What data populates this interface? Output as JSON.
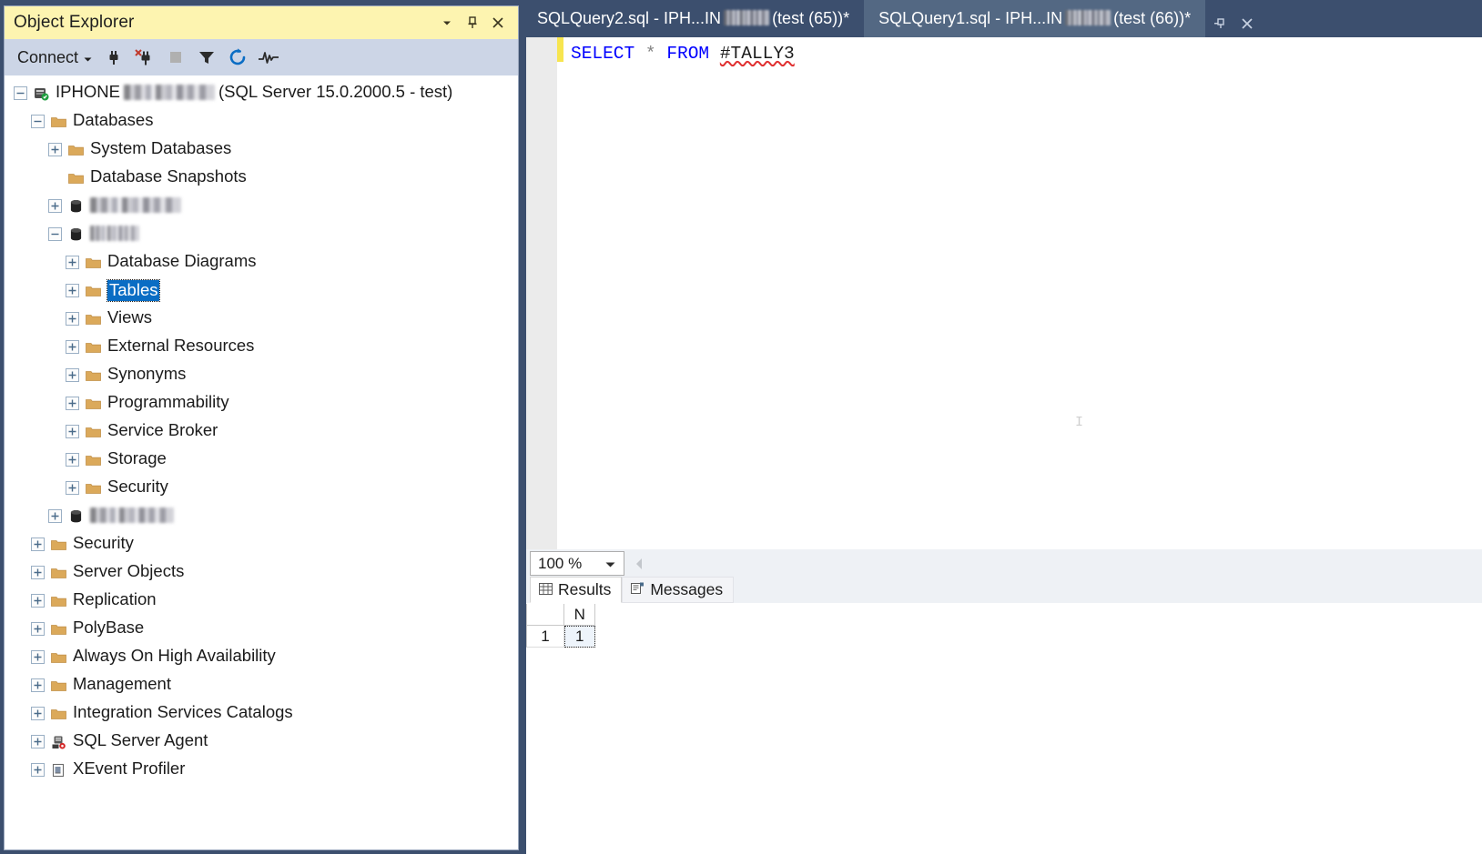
{
  "object_explorer": {
    "title": "Object Explorer",
    "titlebar_buttons": [
      {
        "name": "window-dropdown-icon",
        "glyph": "▼"
      },
      {
        "name": "pin-icon",
        "glyph": "pin"
      },
      {
        "name": "close-icon",
        "glyph": "✕"
      }
    ],
    "toolbar": {
      "connect_label": "Connect",
      "connect_dropdown_glyph": "▾",
      "icons": [
        {
          "name": "connect-icon",
          "title": "Connect"
        },
        {
          "name": "disconnect-icon",
          "title": "Disconnect"
        },
        {
          "name": "stop-icon",
          "title": "Stop"
        },
        {
          "name": "filter-icon",
          "title": "Filter"
        },
        {
          "name": "refresh-icon",
          "title": "Refresh"
        },
        {
          "name": "activity-monitor-icon",
          "title": "Activity Monitor"
        }
      ]
    },
    "tree": [
      {
        "label": "IPHONE",
        "blurred_suffix": true,
        "suffix": " (SQL Server 15.0.2000.5 - test)",
        "indent": 0,
        "expander": "minus",
        "icon": "server-icon"
      },
      {
        "label": "Databases",
        "indent": 1,
        "expander": "minus",
        "icon": "folder-icon"
      },
      {
        "label": "System Databases",
        "indent": 2,
        "expander": "plus",
        "icon": "folder-icon"
      },
      {
        "label": "Database Snapshots",
        "indent": 2,
        "expander": "none",
        "icon": "folder-icon"
      },
      {
        "label": "",
        "blurred_only": true,
        "blur_width": 100,
        "indent": 2,
        "expander": "plus",
        "icon": "database-icon"
      },
      {
        "label": "",
        "blurred_only": true,
        "blur_width": 54,
        "indent": 2,
        "expander": "minus",
        "icon": "database-icon"
      },
      {
        "label": "Database Diagrams",
        "indent": 3,
        "expander": "plus",
        "icon": "folder-icon"
      },
      {
        "label": "Tables",
        "indent": 3,
        "expander": "plus",
        "icon": "folder-icon",
        "selected": true
      },
      {
        "label": "Views",
        "indent": 3,
        "expander": "plus",
        "icon": "folder-icon"
      },
      {
        "label": "External Resources",
        "indent": 3,
        "expander": "plus",
        "icon": "folder-icon"
      },
      {
        "label": "Synonyms",
        "indent": 3,
        "expander": "plus",
        "icon": "folder-icon"
      },
      {
        "label": "Programmability",
        "indent": 3,
        "expander": "plus",
        "icon": "folder-icon"
      },
      {
        "label": "Service Broker",
        "indent": 3,
        "expander": "plus",
        "icon": "folder-icon"
      },
      {
        "label": "Storage",
        "indent": 3,
        "expander": "plus",
        "icon": "folder-icon"
      },
      {
        "label": "Security",
        "indent": 3,
        "expander": "plus",
        "icon": "folder-icon"
      },
      {
        "label": "",
        "blurred_only": true,
        "blur_width": 92,
        "indent": 2,
        "expander": "plus",
        "icon": "database-icon"
      },
      {
        "label": "Security",
        "indent": 1,
        "expander": "plus",
        "icon": "folder-icon"
      },
      {
        "label": "Server Objects",
        "indent": 1,
        "expander": "plus",
        "icon": "folder-icon"
      },
      {
        "label": "Replication",
        "indent": 1,
        "expander": "plus",
        "icon": "folder-icon"
      },
      {
        "label": "PolyBase",
        "indent": 1,
        "expander": "plus",
        "icon": "folder-icon"
      },
      {
        "label": "Always On High Availability",
        "indent": 1,
        "expander": "plus",
        "icon": "folder-icon"
      },
      {
        "label": "Management",
        "indent": 1,
        "expander": "plus",
        "icon": "folder-icon"
      },
      {
        "label": "Integration Services Catalogs",
        "indent": 1,
        "expander": "plus",
        "icon": "folder-icon"
      },
      {
        "label": "SQL Server Agent",
        "indent": 1,
        "expander": "plus",
        "icon": "agent-icon"
      },
      {
        "label": "XEvent Profiler",
        "indent": 1,
        "expander": "plus",
        "icon": "xevent-icon"
      }
    ]
  },
  "tabs": [
    {
      "prefix": "SQLQuery2.sql - IPH...IN",
      "blurred": true,
      "suffix": " (test (65))*",
      "active": false
    },
    {
      "prefix": "SQLQuery1.sql - IPH...IN",
      "blurred": true,
      "suffix": " (test (66))*",
      "active": true
    }
  ],
  "tab_controls": [
    {
      "name": "pin-tab-icon"
    },
    {
      "name": "close-tab-icon"
    }
  ],
  "editor": {
    "code_tokens": [
      {
        "text": "SELECT",
        "type": "keyword"
      },
      {
        "text": " ",
        "type": "plain"
      },
      {
        "text": "*",
        "type": "operator"
      },
      {
        "text": " ",
        "type": "plain"
      },
      {
        "text": "FROM",
        "type": "keyword"
      },
      {
        "text": " ",
        "type": "plain"
      },
      {
        "text": "#TALLY3",
        "type": "identifier-error"
      }
    ],
    "full_text": "SELECT * FROM #TALLY3"
  },
  "zoom_bar": {
    "zoom_level": "100 %"
  },
  "results": {
    "tabs": [
      {
        "label": "Results",
        "icon": "grid-icon",
        "active": true
      },
      {
        "label": "Messages",
        "icon": "message-icon",
        "active": false
      }
    ],
    "grid": {
      "columns": [
        "",
        "N"
      ],
      "rows": [
        {
          "rownum": "1",
          "values": [
            "1"
          ]
        }
      ]
    }
  },
  "colors": {
    "title_bar": "#fdf4b0",
    "toolbar": "#ccd5e6",
    "chrome": "#3c4f6e",
    "active_tab": "#536883",
    "selection": "#0a6dc4",
    "keyword": "#0000ff",
    "operator": "#808080",
    "error_squiggle": "#e03030",
    "change_bar": "#f7e54f",
    "folder": "#dba95a"
  }
}
